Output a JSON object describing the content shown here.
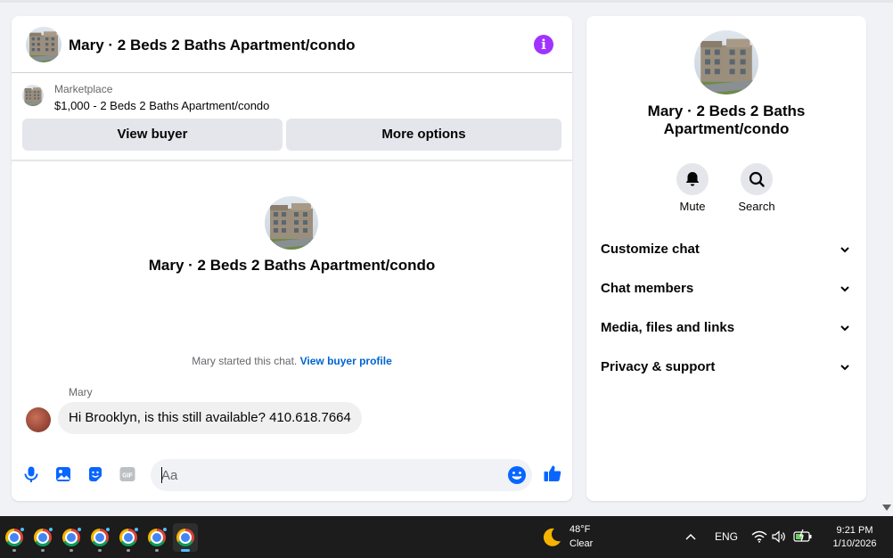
{
  "chat": {
    "title": "Mary · 2 Beds 2 Baths Apartment/condo",
    "listing": {
      "source": "Marketplace",
      "price_title": "$1,000 - 2 Beds 2 Baths Apartment/condo",
      "view_buyer_label": "View buyer",
      "more_options_label": "More options"
    },
    "intro_title": "Mary · 2 Beds 2 Baths Apartment/condo",
    "started_text": "Mary started this chat.",
    "view_profile_link": "View buyer profile",
    "messages": [
      {
        "sender": "Mary",
        "text": "Hi Brooklyn, is this still available? 410.618.7664"
      }
    ],
    "composer": {
      "placeholder": "Aa",
      "icons": [
        "microphone-icon",
        "photo-icon",
        "sticker-icon",
        "gif-icon",
        "emoji-icon",
        "thumbs-up-icon"
      ],
      "gif_label": "GIF"
    },
    "accent_color": "#0866ff",
    "info_color": "#a033ff"
  },
  "sidebar": {
    "name": "Mary · 2 Beds 2 Baths Apartment/condo",
    "actions": [
      {
        "label": "Mute",
        "icon": "bell-icon"
      },
      {
        "label": "Search",
        "icon": "search-icon"
      }
    ],
    "sections": [
      {
        "label": "Customize chat"
      },
      {
        "label": "Chat members"
      },
      {
        "label": "Media, files and links"
      },
      {
        "label": "Privacy & support"
      }
    ]
  },
  "taskbar": {
    "apps": [
      "chrome",
      "chrome",
      "chrome",
      "chrome",
      "chrome",
      "chrome",
      "chrome"
    ],
    "weather": {
      "temp": "48°F",
      "condition": "Clear",
      "icon": "moon-icon"
    },
    "language": "ENG",
    "time": "9:21 PM",
    "date": "1/10/2026"
  }
}
